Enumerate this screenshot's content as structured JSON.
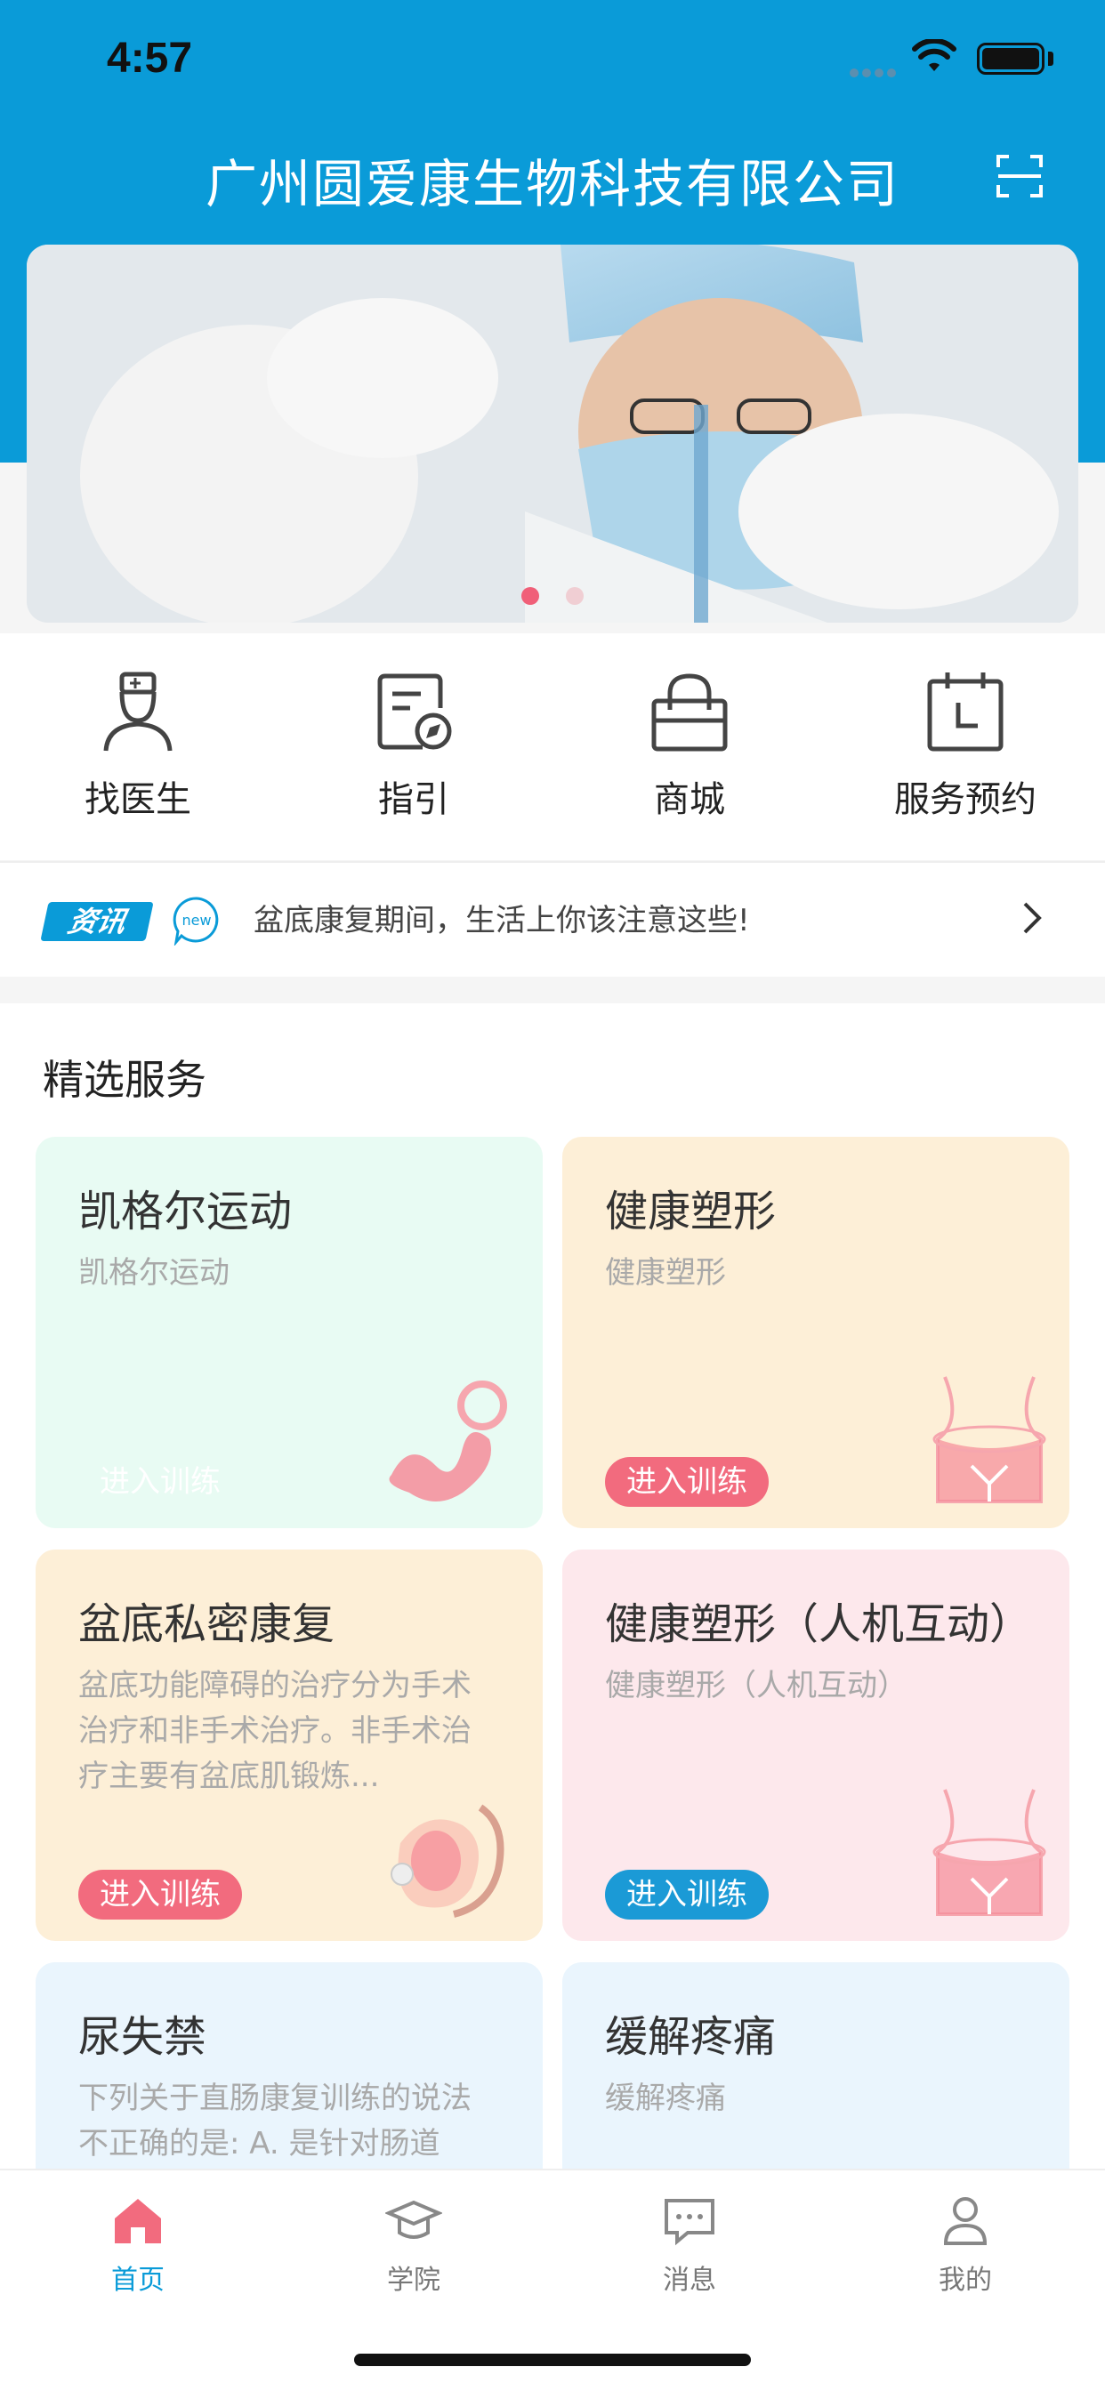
{
  "status_bar": {
    "time": "4:57"
  },
  "header": {
    "title": "广州圆爱康生物科技有限公司",
    "scan_icon": "scan-icon"
  },
  "banner": {
    "slides_total": 2,
    "active_slide": 1
  },
  "quick_actions": [
    {
      "label": "找医生",
      "icon": "doctor-icon"
    },
    {
      "label": "指引",
      "icon": "guide-icon"
    },
    {
      "label": "商城",
      "icon": "shopping-bag-icon"
    },
    {
      "label": "服务预约",
      "icon": "calendar-icon"
    }
  ],
  "news": {
    "tag": "资讯",
    "badge": "new",
    "headline": "盆底康复期间，生活上你该注意这些!"
  },
  "featured": {
    "title": "精选服务",
    "cards": [
      {
        "title": "凯格尔运动",
        "subtitle": "凯格尔运动",
        "button": "进入训练",
        "bg": "#e8fbf3",
        "button_color": "#ffffff"
      },
      {
        "title": "健康塑形",
        "subtitle": "健康塑形",
        "button": "进入训练",
        "bg": "#fdefd7",
        "button_color": "#f26b7e"
      },
      {
        "title": "盆底私密康复",
        "subtitle": "盆底功能障碍的治疗分为手术治疗和非手术治疗。非手术治疗主要有盆底肌锻炼...",
        "button": "进入训练",
        "bg": "#fdefd7",
        "button_color": "#f26b7e"
      },
      {
        "title": "健康塑形（人机互动）",
        "subtitle": "健康塑形（人机互动）",
        "button": "进入训练",
        "bg": "#fde8ec",
        "button_color": "#1b9ad6"
      },
      {
        "title": "尿失禁",
        "subtitle": "下列关于直肠康复训练的说法不正确的是: A. 是针对肠道",
        "button": "",
        "bg": "#eaf5fd",
        "button_color": ""
      },
      {
        "title": "缓解疼痛",
        "subtitle": "缓解疼痛",
        "button": "",
        "bg": "#eaf5fd",
        "button_color": ""
      }
    ]
  },
  "tabbar": [
    {
      "label": "首页",
      "icon": "home-icon",
      "active": true
    },
    {
      "label": "学院",
      "icon": "graduation-cap-icon",
      "active": false
    },
    {
      "label": "消息",
      "icon": "message-icon",
      "active": false
    },
    {
      "label": "我的",
      "icon": "user-icon",
      "active": false
    }
  ],
  "colors": {
    "primary": "#0a9bd8",
    "accent_pink": "#f26b7e"
  }
}
